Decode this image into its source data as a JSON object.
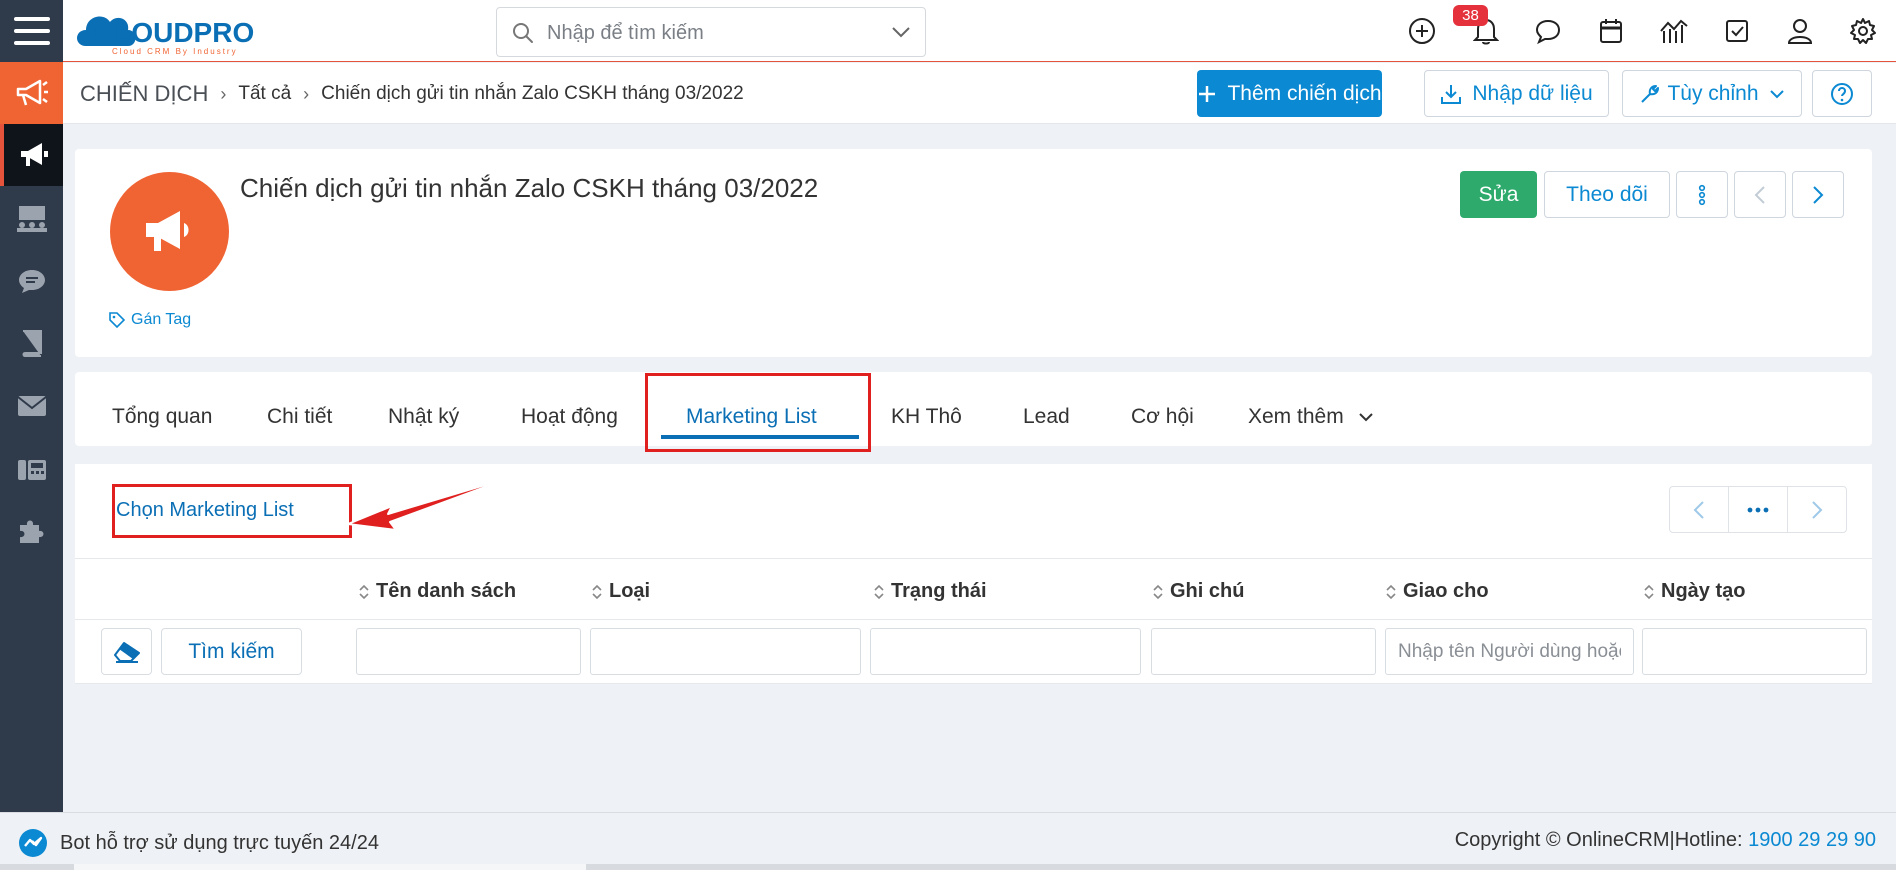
{
  "header": {
    "search_placeholder": "Nhập để tìm kiếm",
    "notification_count": "38",
    "logo_text": "CLOUDPRO",
    "logo_tagline": "Cloud CRM By Industry"
  },
  "breadcrumb": {
    "module": "CHIẾN DỊCH",
    "level1": "Tất cả",
    "level2": "Chiến dịch gửi tin nhắn Zalo CSKH tháng 03/2022"
  },
  "actions": {
    "add": "Thêm chiến dịch",
    "import": "Nhập dữ liệu",
    "customize": "Tùy chỉnh"
  },
  "record": {
    "title": "Chiến dịch gửi tin nhắn Zalo CSKH tháng 03/2022",
    "tag_label": "Gán Tag",
    "edit": "Sửa",
    "follow": "Theo dõi"
  },
  "tabs": [
    {
      "label": "Tổng quan"
    },
    {
      "label": "Chi tiết"
    },
    {
      "label": "Nhật ký"
    },
    {
      "label": "Hoạt động"
    },
    {
      "label": "Marketing List"
    },
    {
      "label": "KH Thô"
    },
    {
      "label": "Lead"
    },
    {
      "label": "Cơ hội"
    },
    {
      "label": "Xem thêm"
    }
  ],
  "panel": {
    "select_label": "Chọn Marketing List",
    "columns": [
      "Tên danh sách",
      "Loại",
      "Trạng thái",
      "Ghi chú",
      "Giao cho",
      "Ngày tạo"
    ],
    "search_button": "Tìm kiếm",
    "assign_placeholder": "Nhập tên Người dùng hoặc nhóm"
  },
  "footer": {
    "bot_text": "Bot hỗ trợ sử dụng trực tuyến 24/24",
    "copyright": "Copyright © OnlineCRM",
    "hotline_label": "|Hotline: ",
    "hotline_number": "1900 29 29 90"
  },
  "colors": {
    "brand_blue": "#0b89d2",
    "sidebar": "#2f3a4a",
    "orange": "#f06433",
    "success": "#2eaa6d",
    "annotation_red": "#e01f1f"
  }
}
